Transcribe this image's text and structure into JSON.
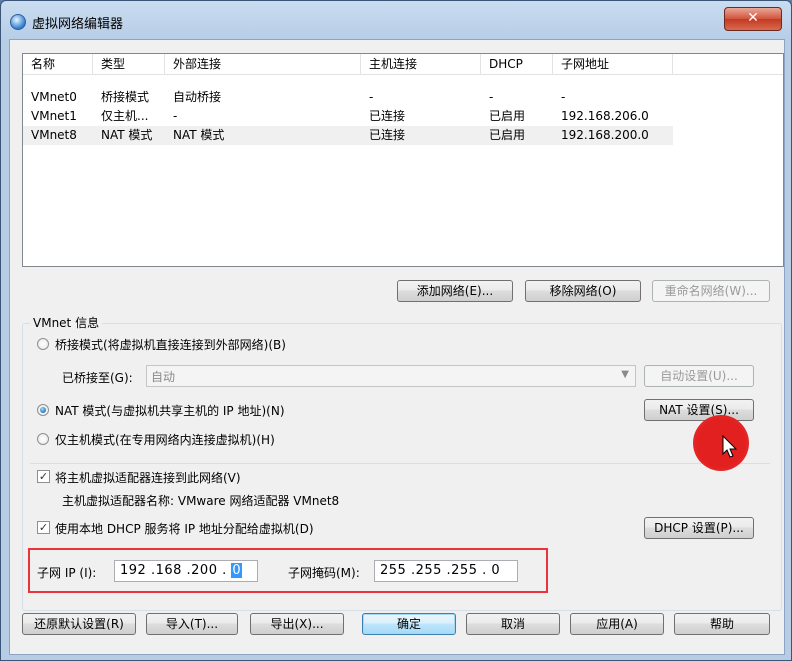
{
  "window": {
    "title": "虚拟网络编辑器",
    "close_label": "✕"
  },
  "list": {
    "columns": [
      "名称",
      "类型",
      "外部连接",
      "主机连接",
      "DHCP",
      "子网地址"
    ],
    "rows": [
      [
        "VMnet0",
        "桥接模式",
        "自动桥接",
        "-",
        "-",
        "-"
      ],
      [
        "VMnet1",
        "仅主机...",
        "-",
        "已连接",
        "已启用",
        "192.168.206.0"
      ],
      [
        "VMnet8",
        "NAT 模式",
        "NAT 模式",
        "已连接",
        "已启用",
        "192.168.200.0"
      ]
    ]
  },
  "list_buttons": {
    "add": "添加网络(E)...",
    "remove": "移除网络(O)",
    "rename": "重命名网络(W)..."
  },
  "vmnet_info": {
    "group_label": "VMnet 信息",
    "bridge_mode": "桥接模式(将虚拟机直接连接到外部网络)(B)",
    "bridged_to_label": "已桥接至(G):",
    "bridged_to_value": "自动",
    "auto_settings": "自动设置(U)...",
    "nat_mode": "NAT 模式(与虚拟机共享主机的 IP 地址)(N)",
    "nat_settings": "NAT 设置(S)...",
    "host_only_mode": "仅主机模式(在专用网络内连接虚拟机)(H)",
    "connect_adapter": "将主机虚拟适配器连接到此网络(V)",
    "adapter_name": "主机虚拟适配器名称: VMware 网络适配器 VMnet8",
    "use_dhcp": "使用本地 DHCP 服务将 IP 地址分配给虚拟机(D)",
    "dhcp_settings": "DHCP 设置(P)...",
    "subnet_ip_label": "子网 IP (I):",
    "subnet_ip_prefix": "192 .168 .200 . ",
    "subnet_ip_last": "0",
    "subnet_mask_label": "子网掩码(M):",
    "subnet_mask_value": "255 .255 .255 . 0"
  },
  "bottom_buttons": {
    "restore": "还原默认设置(R)",
    "import": "导入(T)...",
    "export": "导出(X)...",
    "ok": "确定",
    "cancel": "取消",
    "apply": "应用(A)",
    "help": "帮助"
  }
}
